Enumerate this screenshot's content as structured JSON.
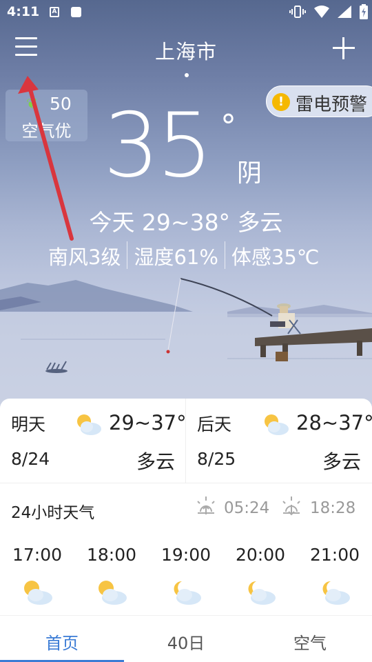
{
  "status_bar": {
    "time": "4:11",
    "notif_icon_letter": "A"
  },
  "header": {
    "city": "上海市"
  },
  "air_quality": {
    "value": "50",
    "label": "空气优"
  },
  "warning": {
    "icon": "!",
    "text": "雷电预警"
  },
  "current": {
    "temperature": "35",
    "degree_symbol": "°",
    "condition": "阴",
    "today_summary": "今天 29~38° 多云",
    "wind": "南风3级",
    "humidity": "湿度61%",
    "feels_like": "体感35℃"
  },
  "forecast": [
    {
      "day": "明天",
      "date": "8/24",
      "range": "29~37°",
      "condition": "多云",
      "icon": "partly-cloudy-icon"
    },
    {
      "day": "后天",
      "date": "8/25",
      "range": "28~37°",
      "condition": "多云",
      "icon": "partly-cloudy-icon"
    }
  ],
  "hourly": {
    "title": "24小时天气",
    "sunrise": "05:24",
    "sunset": "18:28",
    "hours": [
      {
        "time": "17:00",
        "icon": "partly-cloudy-day-icon"
      },
      {
        "time": "18:00",
        "icon": "partly-cloudy-day-icon"
      },
      {
        "time": "19:00",
        "icon": "partly-cloudy-night-icon"
      },
      {
        "time": "20:00",
        "icon": "partly-cloudy-night-icon"
      },
      {
        "time": "21:00",
        "icon": "partly-cloudy-night-icon"
      }
    ]
  },
  "tabs": [
    {
      "label": "首页",
      "active": true
    },
    {
      "label": "40日",
      "active": false
    },
    {
      "label": "空气",
      "active": false
    }
  ],
  "colors": {
    "accent": "#3a7bd5",
    "warning": "#f5b800",
    "annotation_arrow": "#d9363e"
  }
}
